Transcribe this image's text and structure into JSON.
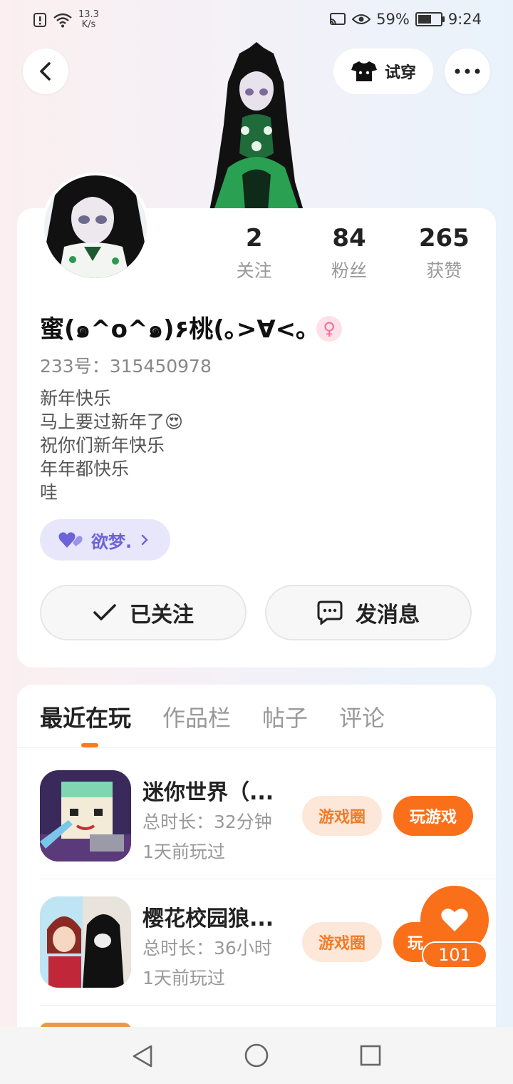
{
  "status": {
    "speed_top": "13.3",
    "speed_bottom": "K/s",
    "battery": "59%",
    "battery_level": 0.59,
    "time": "9:24"
  },
  "header": {
    "try_on_label": "试穿"
  },
  "stats": [
    {
      "num": "2",
      "label": "关注"
    },
    {
      "num": "84",
      "label": "粉丝"
    },
    {
      "num": "265",
      "label": "获赞"
    }
  ],
  "profile": {
    "nickname": "蜜(๑^o^๑)۶桃(｡>∀<｡",
    "id_label": "233号：",
    "id_value": "315450978",
    "bio": [
      "新年快乐",
      "马上要过新年了😍",
      "祝你们新年快乐",
      "年年都快乐",
      "哇"
    ],
    "tag": "欲梦."
  },
  "actions": {
    "follow": "已关注",
    "message": "发消息"
  },
  "tabs": [
    "最近在玩",
    "作品栏",
    "帖子",
    "评论"
  ],
  "games": [
    {
      "title": "迷你世界（...",
      "duration_label": "总时长：32分钟",
      "last_played": "1天前玩过",
      "circle": "游戏圈",
      "play": "玩游戏"
    },
    {
      "title": "樱花校园狼...",
      "duration_label": "总时长：36小时",
      "last_played": "1天前玩过",
      "circle": "游戏圈",
      "play": "玩"
    }
  ],
  "like": {
    "count": "101"
  },
  "colors": {
    "accent": "#fa6f1a",
    "tag_bg": "#e8e6fb",
    "tag_fg": "#6c63d8"
  }
}
